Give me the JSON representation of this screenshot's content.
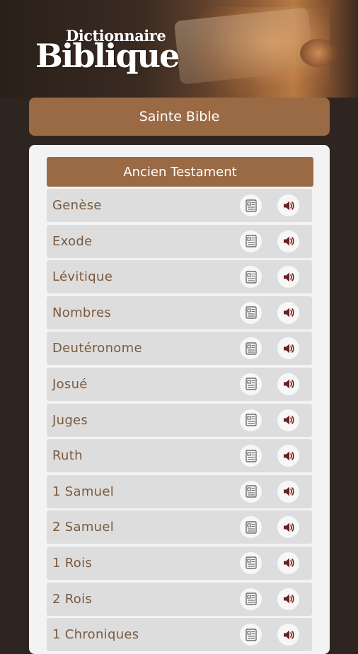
{
  "header": {
    "logo_small": "Dictionnaire",
    "logo_big": "Biblique"
  },
  "title_bar": {
    "label": "Sainte Bible"
  },
  "section": {
    "title": "Ancien Testament"
  },
  "books": [
    {
      "label": "Genèse"
    },
    {
      "label": "Exode"
    },
    {
      "label": "Lévitique"
    },
    {
      "label": "Nombres"
    },
    {
      "label": "Deutéronome"
    },
    {
      "label": "Josué"
    },
    {
      "label": "Juges"
    },
    {
      "label": "Ruth"
    },
    {
      "label": "1 Samuel"
    },
    {
      "label": "2 Samuel"
    },
    {
      "label": "1 Rois"
    },
    {
      "label": "2 Rois"
    },
    {
      "label": "1 Chroniques"
    }
  ],
  "icons": {
    "text": "text-document-icon",
    "audio": "speaker-icon"
  },
  "colors": {
    "accent": "#9a6a45",
    "background": "#2f2520",
    "row": "#dddddd",
    "label": "#7a5a3e",
    "icon": "#6e1f1f"
  }
}
